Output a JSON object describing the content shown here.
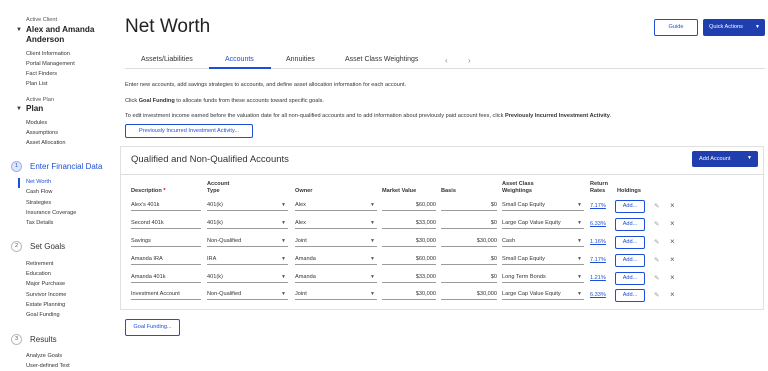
{
  "sidebar": {
    "active_client_label": "Active Client",
    "client_name_line1": "Alex and Amanda",
    "client_name_line2": "Anderson",
    "client_links": [
      "Client Information",
      "Portal Management",
      "Fact Finders",
      "Plan List"
    ],
    "active_plan_label": "Active Plan",
    "plan_name": "Plan",
    "plan_links": [
      "Modules",
      "Assumptions",
      "Asset Allocation"
    ],
    "steps": [
      {
        "number": "1",
        "title": "Enter Financial Data",
        "items": [
          "Net Worth",
          "Cash Flow",
          "Strategies",
          "Insurance Coverage",
          "Tax Details"
        ]
      },
      {
        "number": "2",
        "title": "Set Goals",
        "items": [
          "Retirement",
          "Education",
          "Major Purchase",
          "Survivor Income",
          "Estate Planning",
          "Goal Funding"
        ]
      },
      {
        "number": "3",
        "title": "Results",
        "items": [
          "Analyze Goals",
          "User-defined Text"
        ]
      }
    ]
  },
  "header": {
    "title": "Net Worth",
    "guide_label": "Guide",
    "quick_actions_label": "Quick Actions"
  },
  "tabs": [
    {
      "label": "Assets/Liabilities"
    },
    {
      "label": "Accounts"
    },
    {
      "label": "Annuities"
    },
    {
      "label": "Asset Class Weightings"
    }
  ],
  "info": {
    "line1": "Enter new accounts, add savings strategies to accounts, and define asset allocation information for each account.",
    "line2_prefix": "Click ",
    "line2_bold": "Goal Funding",
    "line2_suffix": " to allocate funds from these accounts toward specific goals.",
    "line3_prefix": "To edit investment income earned before the valuation date for all non-qualified accounts and to add information about previously paid account fees, click ",
    "line3_bold": "Previously Incurred Investment Activity",
    "line3_suffix": ".",
    "prev_button": "Previously Incurred Investment Activity..."
  },
  "panel": {
    "title": "Qualified and Non-Qualified Accounts",
    "add_account_label": "Add Account",
    "columns": {
      "description": "Description",
      "account_type_1": "Account",
      "account_type_2": "Type",
      "owner": "Owner",
      "market_value": "Market Value",
      "basis": "Basis",
      "asset_class_1": "Asset Class",
      "asset_class_2": "Weightings",
      "return_1": "Return",
      "return_2": "Rates",
      "holdings": "Holdings"
    },
    "rows": [
      {
        "description": "Alex's 401k",
        "type": "401(k)",
        "owner": "Alex",
        "market_value": "$60,000",
        "basis": "$0",
        "asset_class": "Small Cap Equity",
        "rate": "7.17%",
        "holdings": "Add..."
      },
      {
        "description": "Second 401k",
        "type": "401(k)",
        "owner": "Alex",
        "market_value": "$33,000",
        "basis": "$0",
        "asset_class": "Large Cap Value Equity",
        "rate": "6.33%",
        "holdings": "Add..."
      },
      {
        "description": "Savings",
        "type": "Non-Qualified",
        "owner": "Joint",
        "market_value": "$30,000",
        "basis": "$30,000",
        "asset_class": "Cash",
        "rate": "1.16%",
        "holdings": "Add..."
      },
      {
        "description": "Amanda IRA",
        "type": "IRA",
        "owner": "Amanda",
        "market_value": "$60,000",
        "basis": "$0",
        "asset_class": "Small Cap Equity",
        "rate": "7.17%",
        "holdings": "Add..."
      },
      {
        "description": "Amanda 401k",
        "type": "401(k)",
        "owner": "Amanda",
        "market_value": "$33,000",
        "basis": "$0",
        "asset_class": "Long Term Bonds",
        "rate": "1.21%",
        "holdings": "Add..."
      },
      {
        "description": "Investment Account",
        "type": "Non-Qualified",
        "owner": "Joint",
        "market_value": "$30,000",
        "basis": "$30,000",
        "asset_class": "Large Cap Value Equity",
        "rate": "6.33%",
        "holdings": "Add..."
      }
    ]
  },
  "goal_funding_label": "Goal Funding...",
  "colors": {
    "accent": "#1e4fd8",
    "button_dark": "#1f3fae"
  },
  "icons": [
    "caret-down-icon",
    "pencil-icon",
    "close-icon",
    "chevron-left-icon",
    "chevron-right-icon"
  ]
}
